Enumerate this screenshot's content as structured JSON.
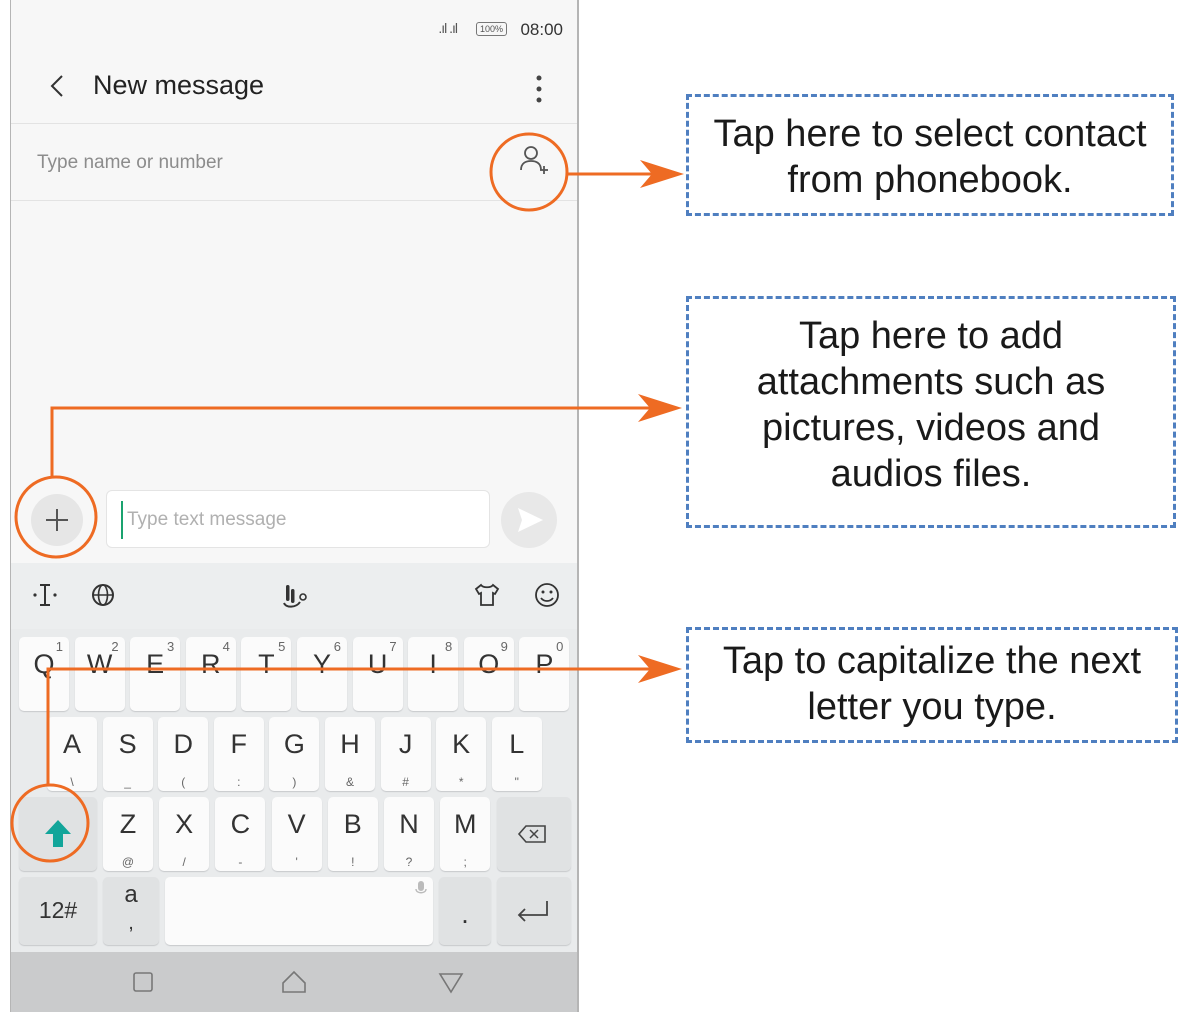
{
  "status_bar": {
    "signal": ".ıl .ıl",
    "battery": "100%",
    "time": "08:00"
  },
  "app_bar": {
    "title": "New message"
  },
  "recipient": {
    "placeholder": "Type name or number"
  },
  "compose": {
    "placeholder": "Type text message"
  },
  "keyboard": {
    "row1": [
      {
        "key": "Q",
        "hint": "1"
      },
      {
        "key": "W",
        "hint": "2"
      },
      {
        "key": "E",
        "hint": "3"
      },
      {
        "key": "R",
        "hint": "4"
      },
      {
        "key": "T",
        "hint": "5"
      },
      {
        "key": "Y",
        "hint": "6"
      },
      {
        "key": "U",
        "hint": "7"
      },
      {
        "key": "I",
        "hint": "8"
      },
      {
        "key": "O",
        "hint": "9"
      },
      {
        "key": "P",
        "hint": "0"
      }
    ],
    "row2": [
      {
        "key": "A",
        "sub": "\\"
      },
      {
        "key": "S",
        "sub": "_"
      },
      {
        "key": "D",
        "sub": "("
      },
      {
        "key": "F",
        "sub": ":"
      },
      {
        "key": "G",
        "sub": ")"
      },
      {
        "key": "H",
        "sub": "&"
      },
      {
        "key": "J",
        "sub": "#"
      },
      {
        "key": "K",
        "sub": "*"
      },
      {
        "key": "L",
        "sub": "\""
      }
    ],
    "row3": [
      {
        "key": "Z",
        "sub": "@"
      },
      {
        "key": "X",
        "sub": "/"
      },
      {
        "key": "C",
        "sub": "-"
      },
      {
        "key": "V",
        "sub": "'"
      },
      {
        "key": "B",
        "sub": "!"
      },
      {
        "key": "N",
        "sub": "?"
      },
      {
        "key": "M",
        "sub": ";"
      }
    ],
    "numbers_label": "12#",
    "lang_main": "a",
    "lang_sub": ",",
    "period": ".",
    "enter": "⮠"
  },
  "callouts": {
    "contact": [
      "Tap here to select contact",
      "from phonebook."
    ],
    "attach": [
      "Tap here to add",
      "attachments such as",
      "pictures, videos and",
      "audios files."
    ],
    "shift": [
      "Tap to capitalize the next",
      "letter you type."
    ]
  },
  "colors": {
    "accent_orange": "#ee6b23",
    "callout_border": "#4f7fc0",
    "shift_teal": "#12a59a"
  }
}
